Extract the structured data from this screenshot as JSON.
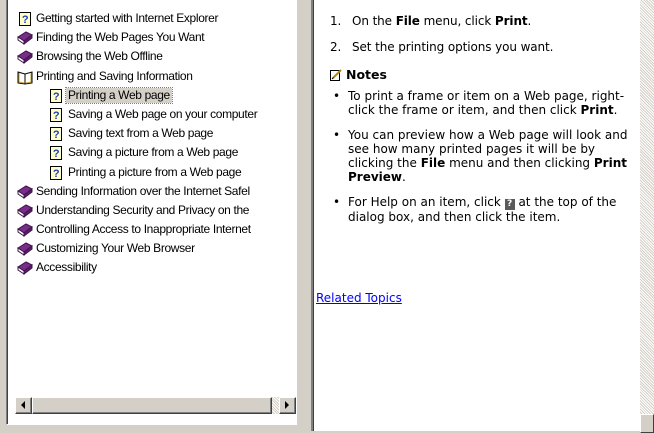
{
  "toc": {
    "items": [
      {
        "label": "Getting started with Internet Explorer",
        "level": 0,
        "icon": "help-topic-icon"
      },
      {
        "label": "Finding the Web Pages You Want",
        "level": 0,
        "icon": "closed-book-icon"
      },
      {
        "label": "Browsing the Web Offline",
        "level": 0,
        "icon": "closed-book-icon"
      },
      {
        "label": "Printing and Saving Information",
        "level": 0,
        "icon": "open-book-icon"
      },
      {
        "label": "Printing a Web page",
        "level": 1,
        "icon": "help-topic-icon",
        "selected": true
      },
      {
        "label": "Saving a Web page on your computer",
        "level": 1,
        "icon": "help-topic-icon"
      },
      {
        "label": "Saving text from a Web page",
        "level": 1,
        "icon": "help-topic-icon"
      },
      {
        "label": "Saving a picture from a Web page",
        "level": 1,
        "icon": "help-topic-icon"
      },
      {
        "label": "Printing a picture from a Web page",
        "level": 1,
        "icon": "help-topic-icon"
      },
      {
        "label": "Sending Information over the Internet Safel",
        "level": 0,
        "icon": "closed-book-icon"
      },
      {
        "label": "Understanding Security and Privacy on the",
        "level": 0,
        "icon": "closed-book-icon"
      },
      {
        "label": "Controlling Access to Inappropriate Internet",
        "level": 0,
        "icon": "closed-book-icon"
      },
      {
        "label": "Customizing Your Web Browser",
        "level": 0,
        "icon": "closed-book-icon"
      },
      {
        "label": "Accessibility",
        "level": 0,
        "icon": "closed-book-icon"
      }
    ]
  },
  "content": {
    "steps": [
      {
        "num": "1.",
        "parts": [
          {
            "t": "On the "
          },
          {
            "t": "File",
            "b": true
          },
          {
            "t": " menu, click "
          },
          {
            "t": "Print",
            "b": true
          },
          {
            "t": "."
          }
        ]
      },
      {
        "num": "2.",
        "parts": [
          {
            "t": "Set the printing options you want."
          }
        ]
      }
    ],
    "notes_heading": "Notes",
    "notes": [
      {
        "parts": [
          {
            "t": "To print a frame or item on a Web page, right-click the frame or item, and then click "
          },
          {
            "t": "Print",
            "b": true
          },
          {
            "t": "."
          }
        ]
      },
      {
        "parts": [
          {
            "t": "You can preview how a Web page will look and see how many printed pages it will be by clicking the "
          },
          {
            "t": "File",
            "b": true
          },
          {
            "t": " menu and then clicking "
          },
          {
            "t": "Print Preview",
            "b": true
          },
          {
            "t": "."
          }
        ]
      },
      {
        "parts": [
          {
            "t": "For Help on an item, click "
          },
          {
            "t": "?",
            "q": true
          },
          {
            "t": " at the top of the dialog box, and then click the item."
          }
        ]
      }
    ],
    "related_link": "Related Topics"
  },
  "colors": {
    "window_bg": "#d4d0c8",
    "link": "#0000ff",
    "book_purple": "#7a2c8c",
    "help_blue": "#1c3fbf"
  }
}
